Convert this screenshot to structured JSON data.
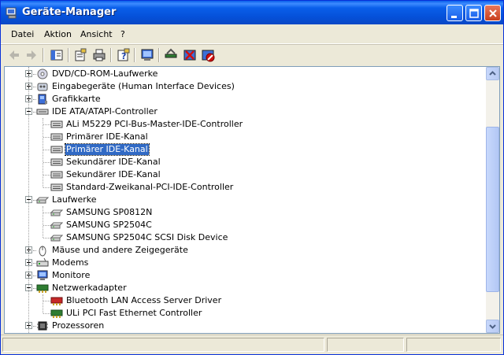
{
  "window": {
    "title": "Geräte-Manager"
  },
  "menu": [
    "Datei",
    "Aktion",
    "Ansicht",
    "?"
  ],
  "toolbar": {
    "buttons": [
      "back-arrow-icon",
      "forward-arrow-icon",
      "show-hide-tree-icon",
      "properties-icon",
      "print-icon",
      "help-icon",
      "scan-hardware-icon",
      "update-driver-icon",
      "uninstall-icon",
      "disable-icon"
    ]
  },
  "tree": {
    "items": [
      {
        "label": "DVD/CD-ROM-Laufwerke",
        "icon": "cdrom-icon",
        "level": 0,
        "expander": "plus"
      },
      {
        "label": "Eingabegeräte (Human Interface Devices)",
        "icon": "hid-icon",
        "level": 0,
        "expander": "plus"
      },
      {
        "label": "Grafikkarte",
        "icon": "display-adapter-icon",
        "level": 0,
        "expander": "plus"
      },
      {
        "label": "IDE ATA/ATAPI-Controller",
        "icon": "ide-controller-icon",
        "level": 0,
        "expander": "minus"
      },
      {
        "label": "ALi M5229 PCI-Bus-Master-IDE-Controller",
        "icon": "ide-channel-icon",
        "level": 1
      },
      {
        "label": "Primärer IDE-Kanal",
        "icon": "ide-channel-icon",
        "level": 1
      },
      {
        "label": "Primärer IDE-Kanal",
        "icon": "ide-channel-icon",
        "level": 1,
        "selected": true
      },
      {
        "label": "Sekundärer IDE-Kanal",
        "icon": "ide-channel-icon",
        "level": 1
      },
      {
        "label": "Sekundärer IDE-Kanal",
        "icon": "ide-channel-icon",
        "level": 1
      },
      {
        "label": "Standard-Zweikanal-PCI-IDE-Controller",
        "icon": "ide-channel-icon",
        "level": 1
      },
      {
        "label": "Laufwerke",
        "icon": "disk-drive-icon",
        "level": 0,
        "expander": "minus"
      },
      {
        "label": "SAMSUNG SP0812N",
        "icon": "disk-drive-icon",
        "level": 1
      },
      {
        "label": "SAMSUNG SP2504C",
        "icon": "disk-drive-icon",
        "level": 1
      },
      {
        "label": "SAMSUNG SP2504C SCSI Disk Device",
        "icon": "disk-drive-icon",
        "level": 1
      },
      {
        "label": "Mäuse und andere Zeigegeräte",
        "icon": "mouse-icon",
        "level": 0,
        "expander": "plus"
      },
      {
        "label": "Modems",
        "icon": "modem-icon",
        "level": 0,
        "expander": "plus"
      },
      {
        "label": "Monitore",
        "icon": "monitor-icon",
        "level": 0,
        "expander": "plus"
      },
      {
        "label": "Netzwerkadapter",
        "icon": "network-adapter-icon",
        "level": 0,
        "expander": "minus"
      },
      {
        "label": "Bluetooth LAN Access Server Driver",
        "icon": "network-adapter-warn-icon",
        "level": 1
      },
      {
        "label": "ULi PCI Fast Ethernet Controller",
        "icon": "network-adapter-icon",
        "level": 1
      },
      {
        "label": "Prozessoren",
        "icon": "processor-icon",
        "level": 0,
        "expander": "plus"
      }
    ]
  },
  "colors": {
    "selection": "#316ac5",
    "titlebar": "#0a5fea"
  }
}
